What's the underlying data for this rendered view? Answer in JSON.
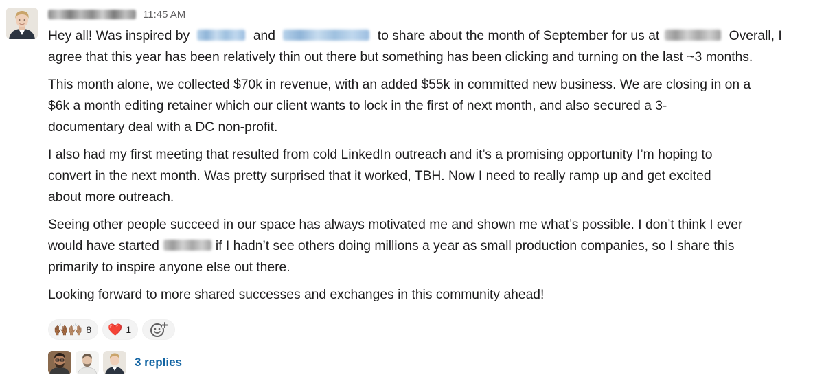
{
  "message": {
    "timestamp": "11:45 AM",
    "p1": {
      "t1": "Hey all! Was inspired by",
      "t2": "and",
      "t3": "to share about the month of September for us at",
      "t4": "Overall, I",
      "t5": "agree that this year has been relatively thin out there but something has been clicking and turning on the last ~3 months."
    },
    "p2": {
      "l1": "This month alone, we collected $70k in revenue, with an added $55k in committed new business. We are closing in on a",
      "l2": "$6k a month editing retainer  which our client wants to lock in the first of next month, and also secured a 3-",
      "l3": "documentary deal with a DC non-profit."
    },
    "p3": {
      "l1": "I also had my first meeting that resulted from cold LinkedIn outreach and it’s a promising opportunity I’m hoping to",
      "l2": "convert in the next month. Was pretty surprised that it worked, TBH. Now I need to really ramp up and get excited",
      "l3": "about more outreach."
    },
    "p4": {
      "l1": "Seeing other people succeed in our space has always motivated me and shown me what’s possible. I don’t think I ever",
      "l2a": "would have started",
      "l2b": "if I hadn’t see others doing millions a year as small production companies, so I share this",
      "l3": "primarily to inspire anyone else out there."
    },
    "p5": "Looking forward to more shared successes and exchanges in this community ahead!"
  },
  "reactions": [
    {
      "icon": "raising-hands-emoji",
      "emoji": "🙌🏾🙌🏽",
      "count": "8"
    },
    {
      "icon": "red-heart-emoji",
      "emoji": "❤️",
      "count": "1"
    }
  ],
  "add_reaction_icon": "add-emoji-icon",
  "thread": {
    "replies_label": "3 replies",
    "link_color": "#1264a3"
  },
  "colors": {
    "text": "#1d1c1d",
    "timestamp": "#616061",
    "reaction_bg": "#f3f3f3"
  }
}
